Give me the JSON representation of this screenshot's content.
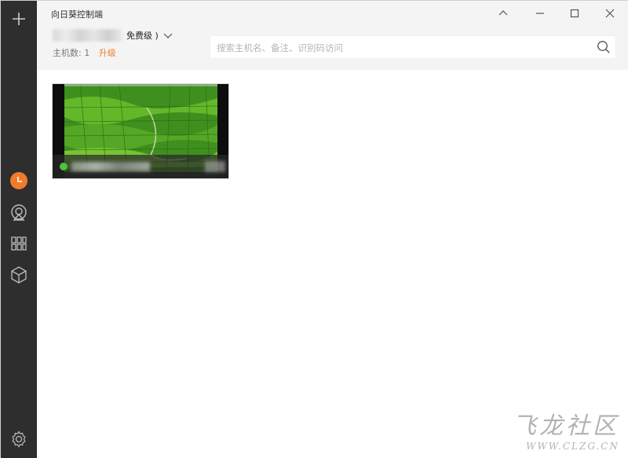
{
  "window": {
    "title": "向日葵控制端"
  },
  "account": {
    "level_text": "免费级 )"
  },
  "host_info": {
    "label": "主机数:",
    "count": "1",
    "upgrade_label": "升级"
  },
  "search": {
    "placeholder": "搜索主机名、备注、识别码访问"
  },
  "sidebar": {
    "items": [
      {
        "icon": "add-icon"
      },
      {
        "icon": "recent-icon",
        "accent": "#f07c2b"
      },
      {
        "icon": "remote-device-icon"
      },
      {
        "icon": "apps-grid-icon"
      },
      {
        "icon": "box-icon"
      },
      {
        "icon": "settings-icon"
      }
    ]
  },
  "hosts": [
    {
      "status": "online",
      "status_color": "#4cc43a"
    }
  ],
  "watermark": {
    "main": "飞龙社区",
    "sub": "WWW.CLZG.CN"
  },
  "colors": {
    "sidebar_bg": "#2e2e2e",
    "accent": "#f07c2b",
    "header_bg": "#f4f4f4"
  }
}
